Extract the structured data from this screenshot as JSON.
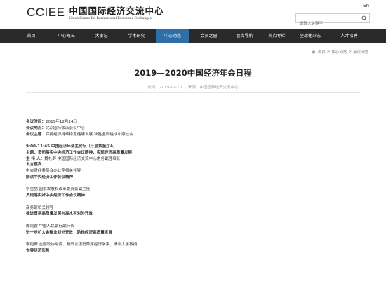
{
  "header": {
    "logo_latin": "CCIEE",
    "logo_cn": "中国国际经济交流中心",
    "logo_en": "China Center for International Economic Exchanges",
    "lang": "En",
    "search_placeholder": "请输入关键字"
  },
  "nav": [
    {
      "label": "首页",
      "active": false
    },
    {
      "label": "中心概况",
      "active": false
    },
    {
      "label": "大事记",
      "active": false
    },
    {
      "label": "学术研究",
      "active": false
    },
    {
      "label": "中心动态",
      "active": true
    },
    {
      "label": "会员之窗",
      "active": false
    },
    {
      "label": "智库导航",
      "active": false
    },
    {
      "label": "热点专栏",
      "active": false
    },
    {
      "label": "全球化杂志",
      "active": false
    },
    {
      "label": "人才招聘",
      "active": false
    }
  ],
  "breadcrumb": [
    "首页",
    "中心动态",
    "会议动态"
  ],
  "article": {
    "title": "2019—2020中国经济年会日程",
    "time": "时间：2019-12-10",
    "source": "来源：中国国际经济交流中心"
  },
  "content": [
    {
      "label": "会议时间：",
      "text": "2019年12月14日"
    },
    {
      "label": "会议地点：",
      "text": "北京国际饭店会议中心"
    },
    {
      "label": "会议主题：",
      "text": "保持经济持续稳定健康发展 决胜全面建成小康社会"
    },
    {
      "gap": true
    },
    {
      "text": "9:00-11:45  中国经济年会主论坛（三层紫金厅A）",
      "bold": true
    },
    {
      "label": "主题：",
      "text": "贯彻落实中央经济工作会议精神，实现经济高质量发展",
      "bold": true
    },
    {
      "label": "主 持 人：",
      "text": "魏礼群   中国国际经济交流中心常务副理事长"
    },
    {
      "label": "发言嘉宾：",
      "text": ""
    },
    {
      "text": "中央财经委员会办公室相关领导"
    },
    {
      "text": "解读中央经济工作会议精神",
      "bold": true
    },
    {
      "gap": true
    },
    {
      "text": "宁吉喆   国家发展和改革委员会副主任"
    },
    {
      "text": "贯彻落实好中央经济工作会议精神",
      "bold": true
    },
    {
      "gap": true
    },
    {
      "text": "商务部相关领导"
    },
    {
      "text": "推进贸易高质量发展与高水平对外开放",
      "bold": true
    },
    {
      "gap": true
    },
    {
      "text": "陈雨露   中国人民银行副行长"
    },
    {
      "text": "进一步扩大金融业对外开放，助推经济高质量发展",
      "bold": true
    },
    {
      "gap": true
    },
    {
      "text": "李稻葵   全国政协常委、新开发银行首席经济学家、清华大学教授"
    },
    {
      "text": "世界经济形势",
      "bold": true
    }
  ]
}
